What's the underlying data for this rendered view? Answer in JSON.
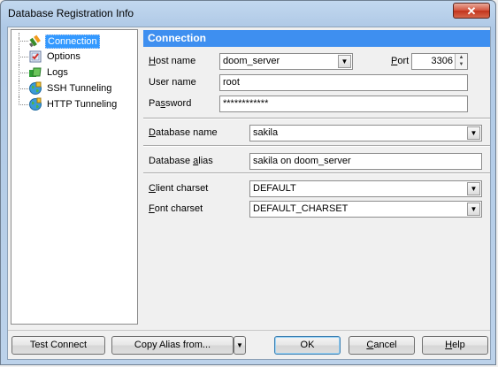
{
  "window": {
    "title": "Database Registration Info",
    "close_glyph": "✕"
  },
  "tree": {
    "items": [
      {
        "label": "Connection",
        "icon": "connection-icon",
        "selected": true
      },
      {
        "label": "Options",
        "icon": "options-icon"
      },
      {
        "label": "Logs",
        "icon": "logs-icon"
      },
      {
        "label": "SSH Tunneling",
        "icon": "ssh-tunneling-icon"
      },
      {
        "label": "HTTP Tunneling",
        "icon": "http-tunneling-icon"
      }
    ]
  },
  "connection": {
    "header": "Connection",
    "host_label_u": "H",
    "host_label_rest": "ost name",
    "host_value": "doom_server",
    "port_label_u": "P",
    "port_label_rest": "ort",
    "port_value": "3306",
    "user_label": "User name",
    "user_value": "root",
    "password_label_pre": "Pa",
    "password_label_u": "s",
    "password_label_rest": "sword",
    "password_value": "************",
    "dbname_label_u": "D",
    "dbname_label_rest": "atabase name",
    "dbname_value": "sakila",
    "alias_label_pre": "Database ",
    "alias_label_u": "a",
    "alias_label_rest": "lias",
    "alias_value": "sakila on doom_server",
    "client_charset_label_u": "C",
    "client_charset_label_rest": "lient charset",
    "client_charset_value": "DEFAULT",
    "font_charset_label_u": "F",
    "font_charset_label_rest": "ont charset",
    "font_charset_value": "DEFAULT_CHARSET"
  },
  "buttons": {
    "test_connect": "Test Connect",
    "copy_alias": "Copy Alias from...",
    "ok": "OK",
    "cancel_u": "C",
    "cancel_rest": "ancel",
    "help_u": "H",
    "help_rest": "elp"
  }
}
